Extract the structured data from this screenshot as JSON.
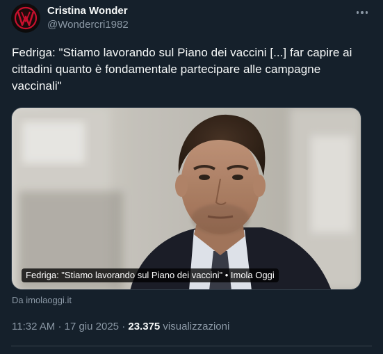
{
  "author": {
    "display_name": "Cristina Wonder",
    "handle": "@Wondercri1982",
    "avatar_icon": "red-w-logo-icon"
  },
  "more_icon": "more-dots-icon",
  "tweet": {
    "text": "Fedriga: \"Stiamo lavorando sul Piano dei vaccini [...] far capire ai cittadini quanto è fondamentale partecipare alle campagne vaccinali\""
  },
  "card": {
    "caption": "Fedriga: \"Stiamo lavorando sul Piano dei vaccini\" • Imola Oggi",
    "source": "Da imolaoggi.it"
  },
  "meta": {
    "time": "11:32 AM",
    "date": "17 giu 2025",
    "views_count": "23.375",
    "views_label": "visualizzazioni",
    "separator": "·"
  },
  "colors": {
    "background": "#15202b",
    "text_primary": "#f7f9f9",
    "text_secondary": "#8b98a5",
    "divider": "#38444d",
    "logo_red": "#c8102e"
  }
}
